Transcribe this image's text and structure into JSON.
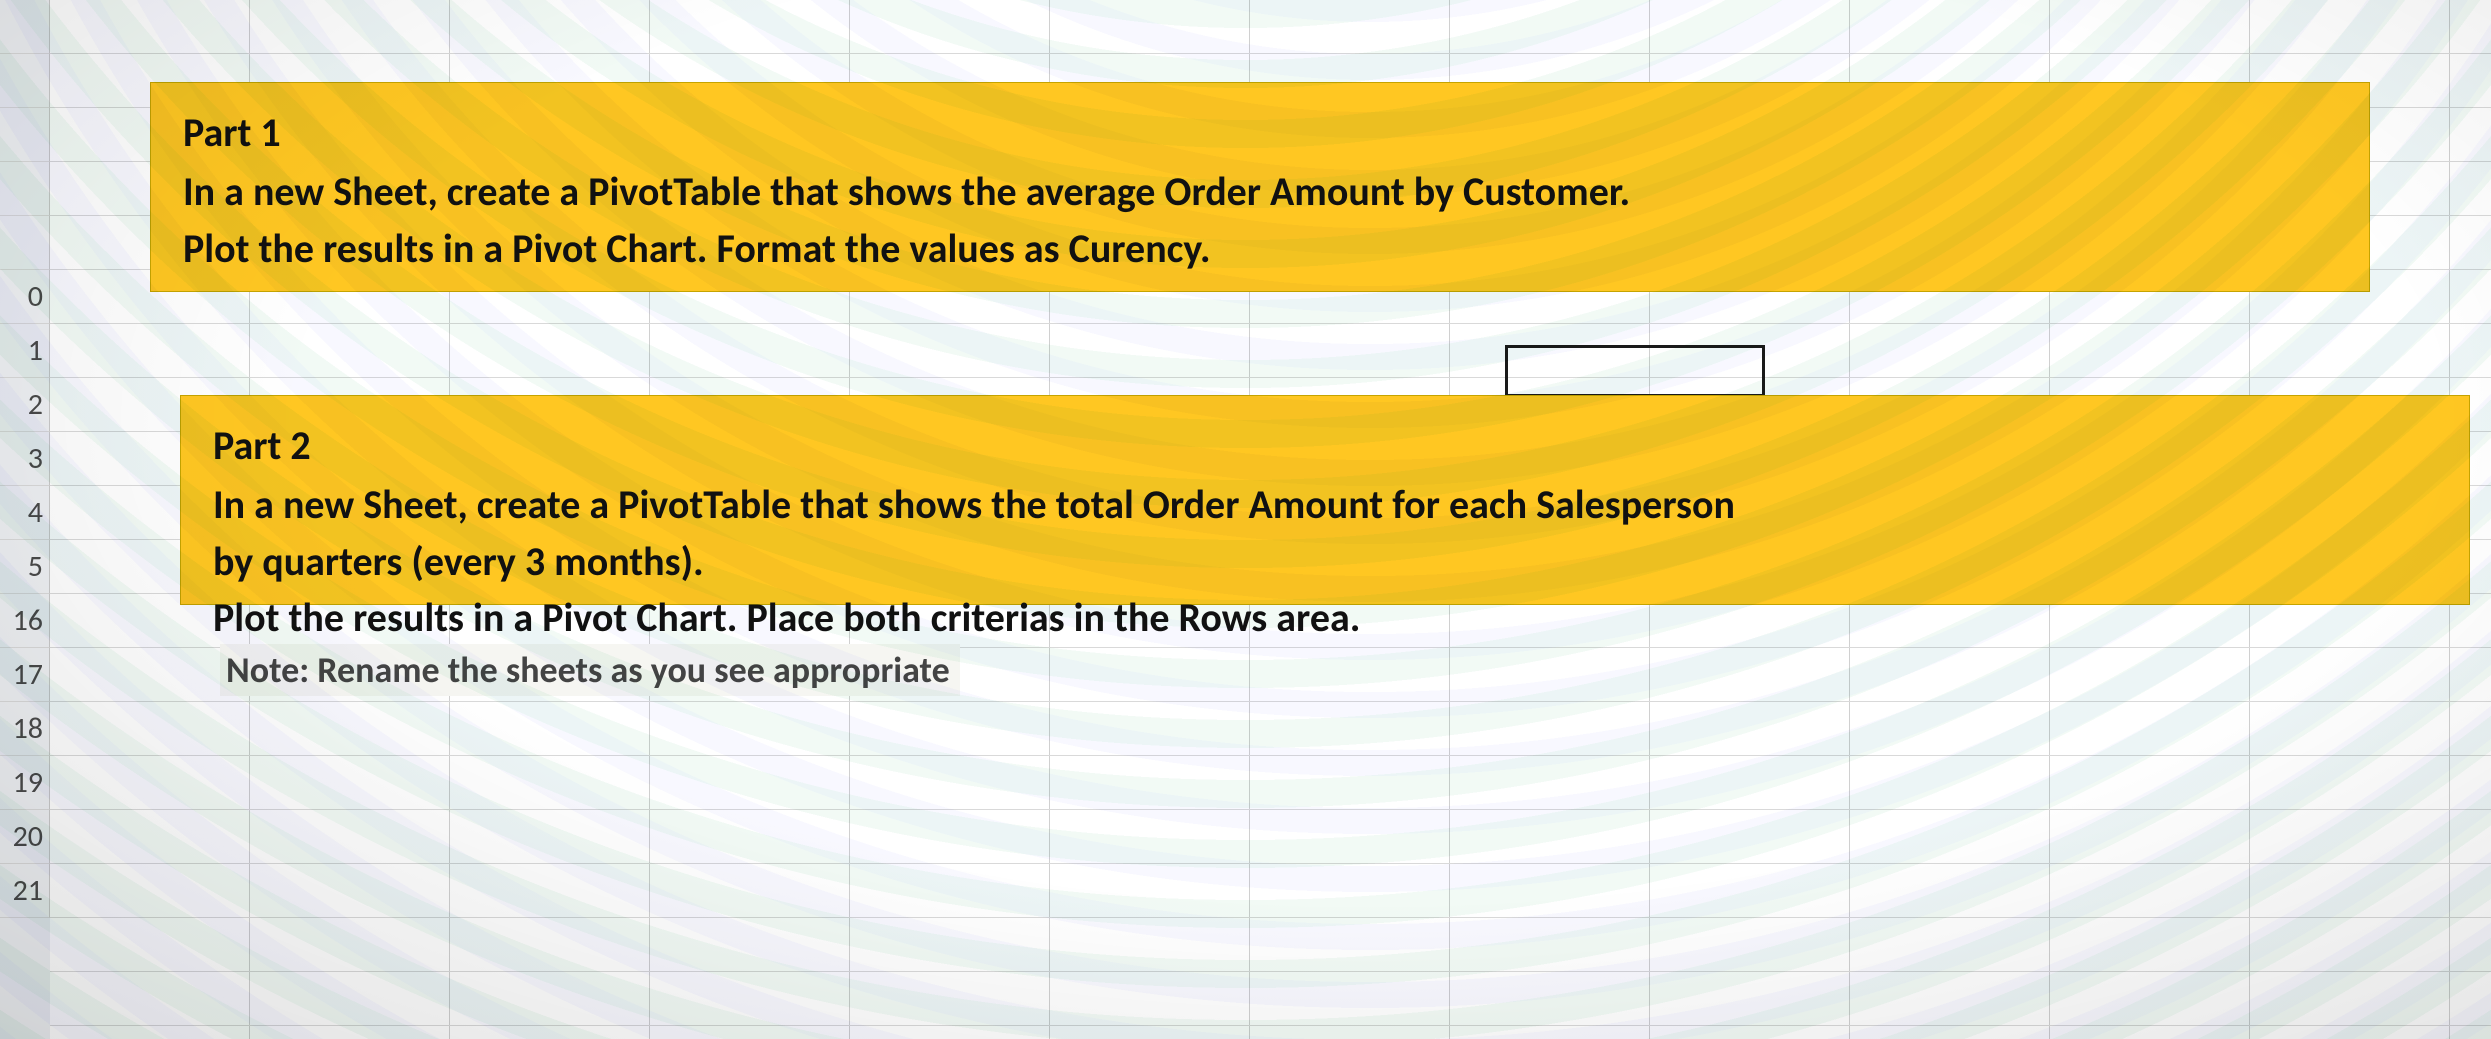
{
  "rowHeaders": [
    "",
    "",
    "",
    "",
    "",
    "0",
    "1",
    "2",
    "3",
    "4",
    "5",
    "16",
    "17",
    "18",
    "19",
    "20",
    "21"
  ],
  "box1": {
    "title": "Part 1",
    "line1": "In a new Sheet, create a PivotTable that shows the average Order Amount by Customer.",
    "line2": "Plot the results in a Pivot Chart. Format the values as Curency."
  },
  "box2": {
    "title": "Part 2",
    "line1": "In a new Sheet, create a PivotTable that shows the total Order Amount for each Salesperson",
    "line2": "by quarters (every 3 months).",
    "line3": "Plot the results in a Pivot Chart. Place both criterias in the Rows area."
  },
  "note": "Note: Rename the sheets as you see appropriate"
}
